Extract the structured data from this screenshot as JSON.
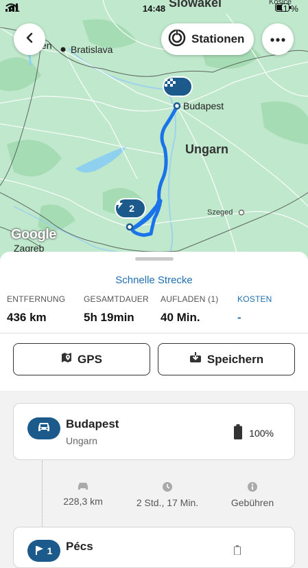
{
  "status_bar": {
    "carrier": "A1",
    "time": "14:48",
    "battery": "41 %"
  },
  "map": {
    "stations_label": "Stationen",
    "stop_badge_count": "2",
    "labels": {
      "top_country": "Slowakei",
      "top_right_city": "Kosice",
      "bratislava": "Bratislava",
      "vienna_fragment": "en",
      "budapest": "Budapest",
      "country": "Ungarn",
      "szeged": "Szeged",
      "zagreb": "Zagreb"
    },
    "attribution": "Google"
  },
  "route": {
    "name": "Schnelle Strecke",
    "stats": [
      {
        "label": "ENTFERNUNG",
        "value": "436 km"
      },
      {
        "label": "GESAMTDAUER",
        "value": "5h 19min"
      },
      {
        "label": "AUFLADEN (1)",
        "value": "40 Min."
      },
      {
        "label": "KOSTEN",
        "value": "-"
      }
    ],
    "buttons": {
      "gps": "GPS",
      "save": "Speichern"
    }
  },
  "stops": [
    {
      "title": "Budapest",
      "subtitle": "Ungarn",
      "battery": "100%"
    },
    {
      "title": "Pécs",
      "badge": "1"
    }
  ],
  "leg": {
    "distance": "228,3 km",
    "duration": "2 Std., 17 Min.",
    "fees": "Gebühren"
  },
  "colors": {
    "accent": "#1f6fb2",
    "route": "#1a73e8",
    "badge": "#1c5a8c",
    "map_bg": "#bfe8cc"
  }
}
